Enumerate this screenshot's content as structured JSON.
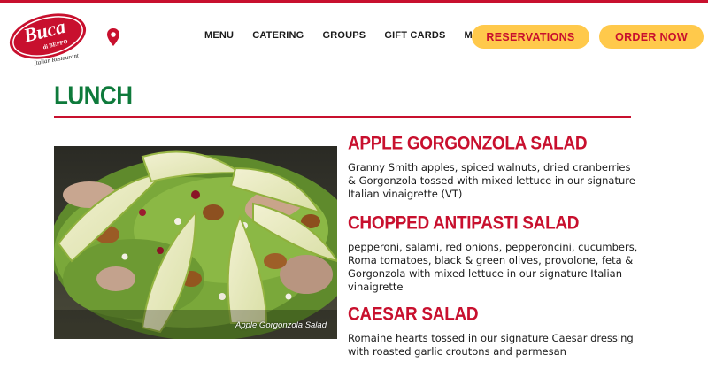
{
  "brand": {
    "logo_line1": "Buca",
    "logo_line2": "di BEPPO",
    "logo_line3": "Italian Restaurant"
  },
  "nav": {
    "items": [
      "MENU",
      "CATERING",
      "GROUPS",
      "GIFT CARDS",
      "MORE"
    ],
    "reservations_label": "RESERVATIONS",
    "order_label": "ORDER NOW"
  },
  "colors": {
    "brand_red": "#c8102e",
    "brand_green": "#0e7a3b",
    "button_yellow": "#ffc94b"
  },
  "section": {
    "title": "LUNCH"
  },
  "photo": {
    "caption": "Apple Gorgonzola Salad"
  },
  "menu_items": [
    {
      "name": "APPLE GORGONZOLA SALAD",
      "description": "Granny Smith apples, spiced walnuts, dried cranberries & Gorgonzola tossed with mixed lettuce in our signature Italian vinaigrette (VT)"
    },
    {
      "name": "CHOPPED ANTIPASTI SALAD",
      "description": "pepperoni, salami, red onions, pepperoncini, cucumbers, Roma tomatoes, black & green olives, provolone, feta & Gorgonzola with mixed lettuce in our signature Italian vinaigrette"
    },
    {
      "name": "CAESAR SALAD",
      "description": "Romaine hearts tossed in our signature Caesar dressing with roasted garlic croutons and parmesan"
    }
  ]
}
